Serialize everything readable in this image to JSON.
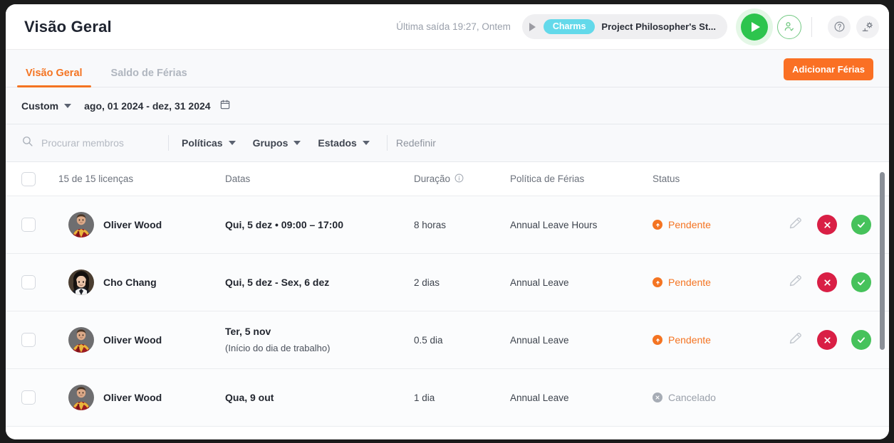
{
  "header": {
    "title": "Visão Geral",
    "last_exit": "Última saída 19:27, Ontem",
    "task": {
      "chip": "Charms",
      "name": "Project Philosopher's St...",
      "play_icon": "play-icon"
    },
    "icons": {
      "start": "play-button-icon",
      "person": "person-check-icon",
      "help": "help-circle-icon",
      "settings": "settings-gear-icon"
    }
  },
  "tabs": [
    {
      "label": "Visão Geral",
      "active": true
    },
    {
      "label": "Saldo de Férias",
      "active": false
    }
  ],
  "actions": {
    "add_vacation": "Adicionar Férias"
  },
  "datebar": {
    "preset": "Custom",
    "range": "ago, 01 2024 - dez, 31 2024",
    "calendar_icon": "calendar-icon"
  },
  "filters": {
    "search_placeholder": "Procurar membros",
    "search_value": "",
    "items": [
      {
        "label": "Políticas"
      },
      {
        "label": "Grupos"
      },
      {
        "label": "Estados"
      }
    ],
    "reset": "Redefinir"
  },
  "table": {
    "headers": {
      "licenses": "15 de 15 licenças",
      "dates": "Datas",
      "duration": "Duração",
      "policy": "Política de Férias",
      "status": "Status"
    },
    "rows": [
      {
        "name": "Oliver Wood",
        "avatar": "oliver-wood-avatar",
        "date": "Qui, 5 dez • 09:00 – 17:00",
        "date_sub": "",
        "duration": "8 horas",
        "policy": "Annual Leave Hours",
        "status": "Pendente",
        "status_type": "pendente",
        "has_actions": true
      },
      {
        "name": "Cho Chang",
        "avatar": "cho-chang-avatar",
        "date": "Qui, 5 dez - Sex, 6 dez",
        "date_sub": "",
        "duration": "2 dias",
        "policy": "Annual Leave",
        "status": "Pendente",
        "status_type": "pendente",
        "has_actions": true
      },
      {
        "name": "Oliver Wood",
        "avatar": "oliver-wood-avatar",
        "date": "Ter, 5 nov",
        "date_sub": "(Início do dia de trabalho)",
        "duration": "0.5 dia",
        "policy": "Annual Leave",
        "status": "Pendente",
        "status_type": "pendente",
        "has_actions": true
      },
      {
        "name": "Oliver Wood",
        "avatar": "oliver-wood-avatar",
        "date": "Qua, 9 out",
        "date_sub": "",
        "duration": "1 dia",
        "policy": "Annual Leave",
        "status": "Cancelado",
        "status_type": "cancelado",
        "has_actions": false
      }
    ]
  },
  "colors": {
    "accent_orange": "#f47422",
    "button_orange": "#fa7024",
    "chip_cyan": "#63d9ea",
    "green": "#2dc44d",
    "red": "#d91f45",
    "approve_green": "#46c25b",
    "gray": "#9aa0aa"
  }
}
